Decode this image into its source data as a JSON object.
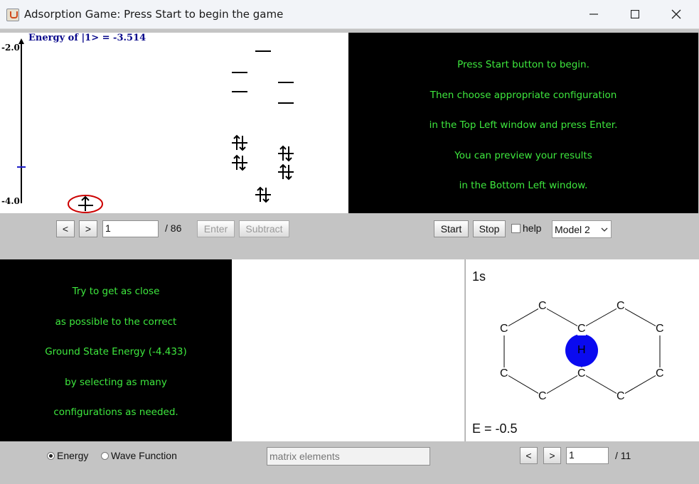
{
  "window": {
    "title": "Adsorption Game: Press Start to begin the game",
    "buttons": {
      "minimize": "minimize-icon",
      "maximize": "maximize-icon",
      "close": "close-icon"
    }
  },
  "energy_panel": {
    "title": "Energy of |1> = -3.514",
    "y_top_label": "-2.0",
    "y_bottom_label": "-4.0",
    "highlight_color": "#cc0000",
    "marker_color": "#1c1cc8"
  },
  "instructions_top": {
    "lines": [
      "Press Start button to begin.",
      "Then choose appropriate configuration",
      "in the Top Left window and press Enter.",
      "You can preview your results",
      "in the Bottom Left window."
    ],
    "color": "#3ee83e"
  },
  "config_controls": {
    "prev_label": "<",
    "next_label": ">",
    "index_value": "1",
    "total_label": "/ 86",
    "enter_label": "Enter",
    "subtract_label": "Subtract"
  },
  "game_controls": {
    "start_label": "Start",
    "stop_label": "Stop",
    "help_label": "help",
    "model_value": "Model 2"
  },
  "instructions_bottom": {
    "lines": [
      "Try to get as close",
      "as possible to the correct",
      "Ground State Energy (-4.433)",
      "by selecting as many",
      "configurations as needed."
    ]
  },
  "molecule_panel": {
    "orbital_label": "1s",
    "energy_label": "E = -0.5",
    "center_atom": "H",
    "atom_label": "C",
    "atom_color": "#0a0af0"
  },
  "bottom_controls": {
    "energy_radio": "Energy",
    "wavefunction_radio": "Wave Function",
    "matrix_placeholder": "matrix elements",
    "prev_label": "<",
    "next_label": ">",
    "index_value": "1",
    "total_label": "/ 11"
  }
}
